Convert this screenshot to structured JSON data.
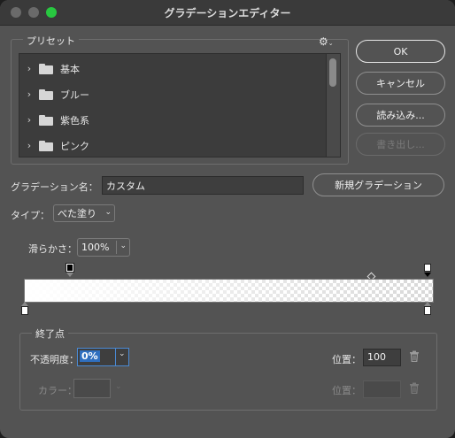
{
  "window": {
    "title": "グラデーションエディター"
  },
  "presets": {
    "label": "プリセット",
    "gear_icon": "gear-icon",
    "items": [
      {
        "label": "基本"
      },
      {
        "label": "ブルー"
      },
      {
        "label": "紫色系"
      },
      {
        "label": "ピンク"
      }
    ]
  },
  "buttons": {
    "ok": "OK",
    "cancel": "キャンセル",
    "load": "読み込み...",
    "export": "書き出し...",
    "new_gradient": "新規グラデーション"
  },
  "name": {
    "label": "グラデーション名：",
    "value": "カスタム"
  },
  "type": {
    "label": "タイプ：",
    "value": "べた塗り"
  },
  "smoothness": {
    "label": "滑らかさ：",
    "value": "100%"
  },
  "stops": {
    "section_label": "終了点",
    "opacity_label": "不透明度：",
    "opacity_value": "0%",
    "opacity_position_label": "位置：",
    "opacity_position_value": "100",
    "color_label": "カラー：",
    "color_position_label": "位置：",
    "color_position_value": ""
  },
  "colors": {
    "panel": "#535353",
    "accent": "#4a8ad4",
    "traffic_green": "#28c840"
  }
}
